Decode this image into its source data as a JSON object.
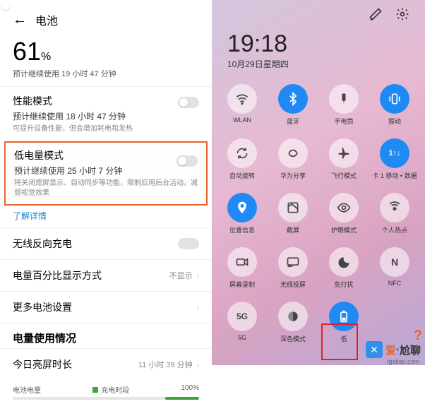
{
  "left": {
    "back_icon": "←",
    "title": "电池",
    "percent_num": "61",
    "percent_sym": "%",
    "est_main": "预计继续使用 19 小时 47 分钟",
    "perf": {
      "title": "性能模式",
      "est": "预计继续使用 18 小时 47 分钟",
      "desc": "可提升设备性能，但会增加耗电和发热"
    },
    "low": {
      "title": "低电量模式",
      "est": "预计继续使用 25 小时 7 分钟",
      "desc": "将关闭熄屏显示、自动同步等功能，限制应用后台活动，减弱视觉效果"
    },
    "learn_more": "了解详情",
    "reverse": "无线反向充电",
    "pct_disp": {
      "label": "电量百分比显示方式",
      "value": "不显示"
    },
    "more": "更多电池设置",
    "usage_h": "电量使用情况",
    "screen_row": {
      "label": "今日亮屏时长",
      "value": "11 小时 39 分钟"
    },
    "bar": {
      "label": "电池电量",
      "charge": "充电时段",
      "pct": "100%"
    }
  },
  "right": {
    "time": "19:18",
    "date": "10月29日星期四",
    "tiles": [
      {
        "name": "wlan",
        "label": "WLAN",
        "on": false,
        "icon": "wifi"
      },
      {
        "name": "bluetooth",
        "label": "蓝牙",
        "on": true,
        "icon": "bt"
      },
      {
        "name": "flashlight",
        "label": "手电筒",
        "on": false,
        "icon": "flash"
      },
      {
        "name": "vibrate",
        "label": "振动",
        "on": true,
        "icon": "vib"
      },
      {
        "name": "autorotate",
        "label": "自动旋转",
        "on": false,
        "icon": "rot"
      },
      {
        "name": "huaweishare",
        "label": "华为分享",
        "on": false,
        "icon": "share"
      },
      {
        "name": "airplane",
        "label": "飞行模式",
        "on": false,
        "icon": "air"
      },
      {
        "name": "mobiledata",
        "label": "卡 1 移动 •\n数据",
        "on": true,
        "icon": "data"
      },
      {
        "name": "location",
        "label": "位置信息",
        "on": true,
        "icon": "loc"
      },
      {
        "name": "screenshot",
        "label": "截屏",
        "on": false,
        "icon": "shot"
      },
      {
        "name": "eyecomfort",
        "label": "护眼模式",
        "on": false,
        "icon": "eye"
      },
      {
        "name": "hotspot",
        "label": "个人热点",
        "on": false,
        "icon": "hot"
      },
      {
        "name": "screenrec",
        "label": "屏幕录制",
        "on": false,
        "icon": "rec"
      },
      {
        "name": "cast",
        "label": "无线投屏",
        "on": false,
        "icon": "cast"
      },
      {
        "name": "dnd",
        "label": "免打扰",
        "on": false,
        "icon": "dnd"
      },
      {
        "name": "nfc",
        "label": "NFC",
        "on": false,
        "icon": "nfc"
      },
      {
        "name": "5g",
        "label": "5G",
        "on": false,
        "icon": "5g"
      },
      {
        "name": "darkmode",
        "label": "深色模式",
        "on": false,
        "icon": "dark"
      },
      {
        "name": "lowbatt",
        "label": "低",
        "on": true,
        "icon": "lowb"
      },
      {
        "name": "pad",
        "label": "",
        "on": false,
        "icon": ""
      }
    ]
  },
  "wm": {
    "t1": "爱",
    "dot": "·",
    "t2": "尬聊",
    "sub": "igaliao.com"
  }
}
